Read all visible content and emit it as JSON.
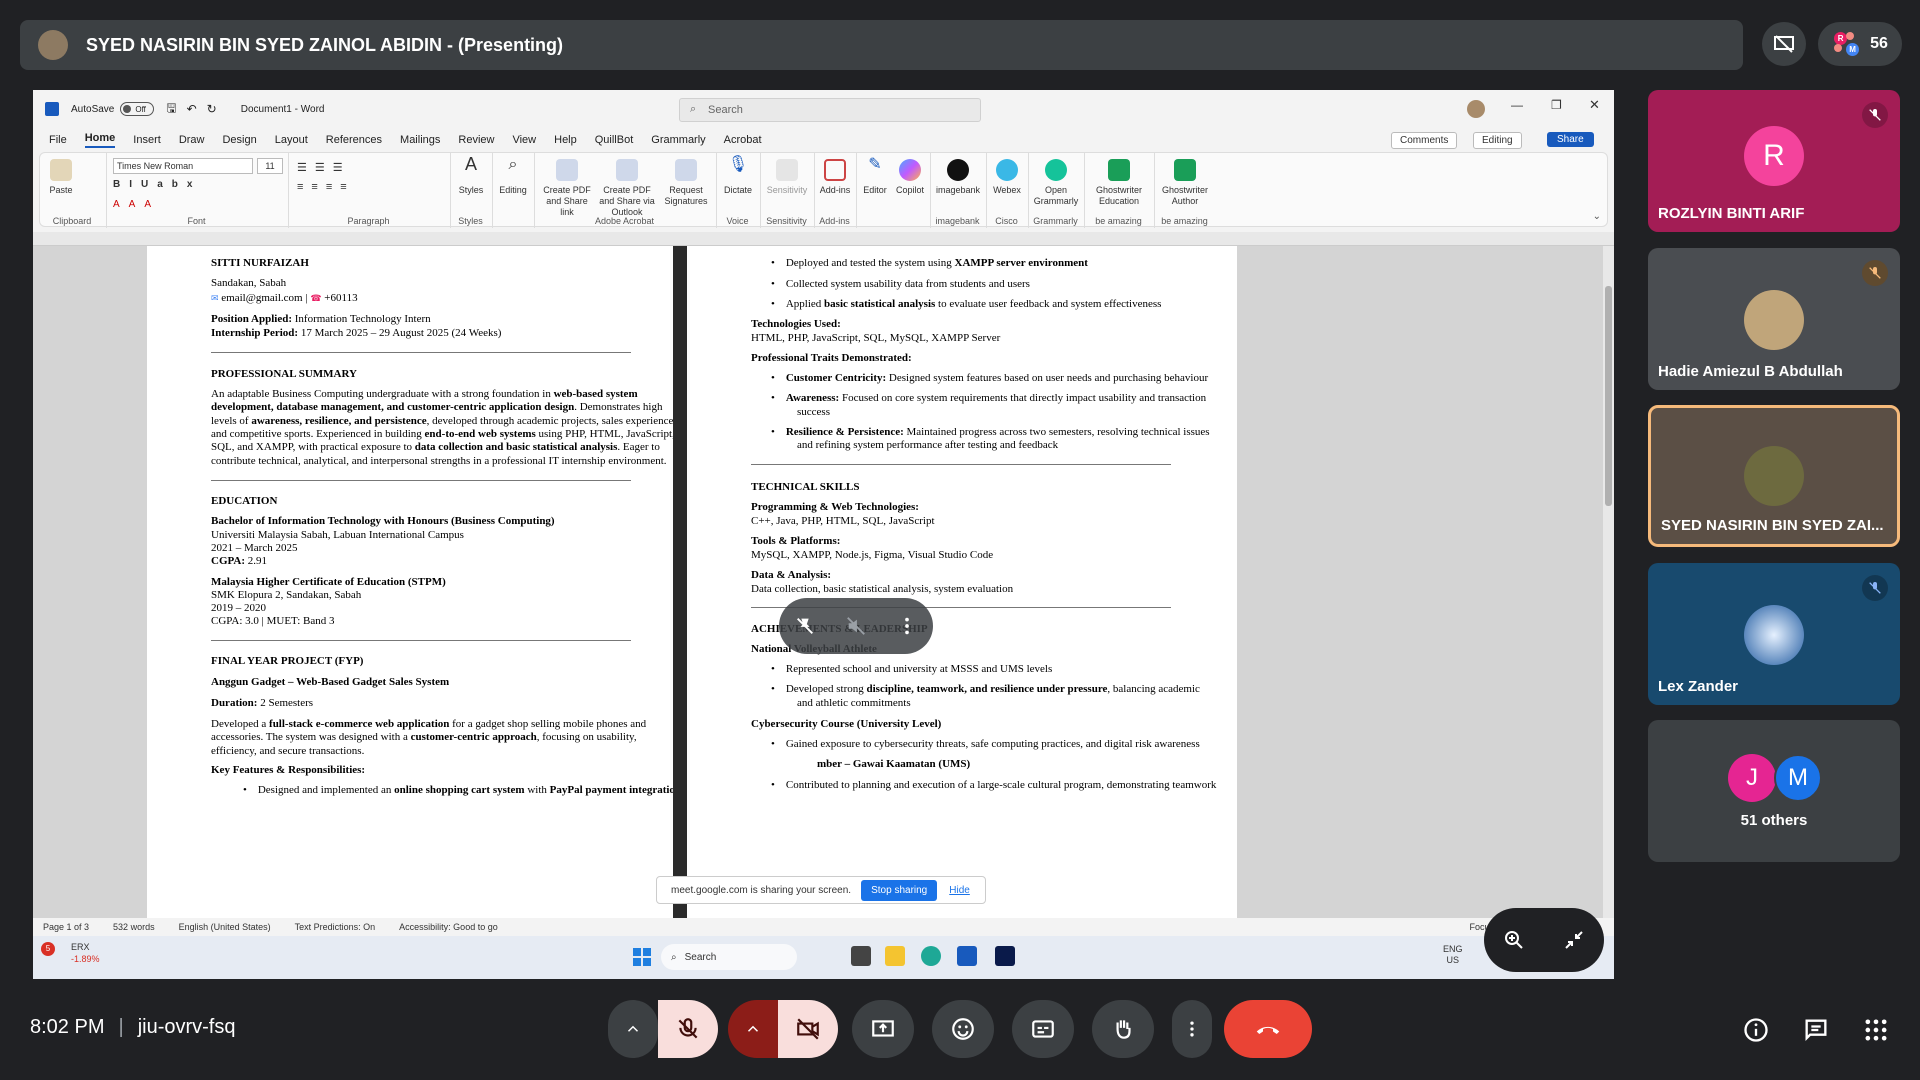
{
  "presenter_bar": {
    "title": "SYED NASIRIN BIN SYED ZAINOL ABIDIN - (Presenting)"
  },
  "top_right": {
    "participants_count": "56",
    "badge_letters": [
      "R",
      "M"
    ]
  },
  "word": {
    "autosave_label": "AutoSave",
    "autosave_state": "Off",
    "doc_title": "Document1 - Word",
    "search_placeholder": "Search",
    "tabs": [
      "File",
      "Home",
      "Insert",
      "Draw",
      "Design",
      "Layout",
      "References",
      "Mailings",
      "Review",
      "View",
      "Help",
      "QuillBot",
      "Grammarly",
      "Acrobat"
    ],
    "comments": "Comments",
    "editing": "Editing",
    "share": "Share",
    "ribbon": {
      "paste": "Paste",
      "clipboard": "Clipboard",
      "font_name": "Times New Roman",
      "font_size": "11",
      "font": "Font",
      "paragraph": "Paragraph",
      "styles_btn": "Styles",
      "styles": "Styles",
      "editing_btn": "Editing",
      "create_pdf": "Create PDF and Share link",
      "create_pdf_outlook": "Create PDF and Share via Outlook",
      "request_sig": "Request Signatures",
      "adobe_acrobat": "Adobe Acrobat",
      "dictate": "Dictate",
      "voice": "Voice",
      "sensitivity_btn": "Sensitivity",
      "sensitivity": "Sensitivity",
      "addins_btn": "Add-ins",
      "addins": "Add-ins",
      "editor": "Editor",
      "copilot": "Copilot",
      "imagebank_btn": "imagebank",
      "imagebank": "imagebank",
      "webex": "Webex",
      "cisco": "Cisco",
      "open_grammarly": "Open Grammarly",
      "grammarly": "Grammarly",
      "ghost_edu": "Ghostwriter Education",
      "ghost_author": "Ghostwriter Author",
      "be_amazing1": "be amazing",
      "be_amazing2": "be amazing"
    },
    "status": {
      "page": "Page 1 of 3",
      "words": "532 words",
      "language": "English (United States)",
      "predictions": "Text Predictions: On",
      "accessibility": "Accessibility: Good to go",
      "focus": "Focus"
    },
    "taskbar": {
      "stock_name": "ERX",
      "stock_change": "-1.89%",
      "stock_badge": "5",
      "search": "Search",
      "lang1": "ENG",
      "lang2": "US"
    }
  },
  "doc_left": {
    "name": "SITTI NURFAIZAH",
    "location": "Sandakan, Sabah",
    "email": "email@gmail.com |",
    "phone": "+60113",
    "pos_label": "Position Applied:",
    "pos_value": " Information Technology Intern",
    "period_label": "Internship Period:",
    "period_value": " 17 March 2025 – 29 August 2025 (24 Weeks)",
    "summary_heading": "PROFESSIONAL SUMMARY",
    "summary": [
      "An adaptable Business Computing undergraduate with a strong foundation in <b>web-based system</b>",
      "<b>development, database management, and customer-centric application design</b>. Demonstrates high",
      "levels of <b>awareness, resilience, and persistence</b>, developed through academic projects, sales experience,",
      "and competitive sports. Experienced in building <b>end-to-end web systems</b> using PHP, HTML, JavaScript,",
      "SQL, and XAMPP, with practical exposure to <b>data collection and basic statistical analysis</b>. Eager to",
      "contribute technical, analytical, and interpersonal strengths in a professional IT internship environment."
    ],
    "education_heading": "EDUCATION",
    "edu1_title": "Bachelor of Information Technology with Honours (Business Computing)",
    "edu1_school": "Universiti Malaysia Sabah, Labuan International Campus",
    "edu1_dates": "2021 – March 2025",
    "edu1_cgpa_label": "CGPA:",
    "edu1_cgpa": " 2.91",
    "edu2_title": "Malaysia Higher Certificate of Education (STPM)",
    "edu2_school": "SMK Elopura 2, Sandakan, Sabah",
    "edu2_dates": "2019 – 2020",
    "edu2_cgpa": "CGPA: 3.0 | MUET: Band 3",
    "fyp_heading": "FINAL YEAR PROJECT (FYP)",
    "fyp_title": "Anggun Gadget – Web-Based Gadget Sales System",
    "fyp_duration_label": "Duration:",
    "fyp_duration": " 2 Semesters",
    "fyp_desc": [
      "Developed a <b>full-stack e-commerce web application</b> for a gadget shop selling mobile phones and",
      "accessories. The system was designed with a <b>customer-centric approach</b>, focusing on usability,",
      "efficiency, and secure transactions."
    ],
    "features_heading": "Key Features & Responsibilities:",
    "features_first": "Designed and implemented an <b>online shopping cart system</b> with <b>PayPal payment integration</b>"
  },
  "doc_right": {
    "bullets_top": [
      "Deployed and tested the system using <b>XAMPP server environment</b>",
      "Collected system usability data from students and users",
      "Applied <b>basic statistical analysis</b> to evaluate user feedback and system effectiveness"
    ],
    "tech_used_label": "Technologies Used:",
    "tech_used": "HTML, PHP, JavaScript, SQL, MySQL, XAMPP Server",
    "traits_label": "Professional Traits Demonstrated:",
    "traits": [
      [
        "<b>Customer Centricity:</b> Designed system features based on user needs and purchasing behaviour"
      ],
      [
        "<b>Awareness:</b> Focused on core system requirements that directly impact usability and transaction",
        "success"
      ],
      [
        "<b>Resilience &amp; Persistence:</b> Maintained progress across two semesters, resolving technical issues",
        "and refining system performance after testing and feedback"
      ]
    ],
    "skills_heading": "TECHNICAL SKILLS",
    "skill1_label": "Programming & Web Technologies:",
    "skill1": "C++, Java, PHP, HTML, SQL, JavaScript",
    "skill2_label": "Tools & Platforms:",
    "skill2": "MySQL, XAMPP, Node.js, Figma, Visual Studio Code",
    "skill3_label": "Data & Analysis:",
    "skill3": "Data collection, basic statistical analysis, system evaluation",
    "ach_heading": "ACHIEVEMENTS & LEADERSHIP",
    "ach1_title": "National Volleyball Athlete",
    "ach1_bullets": [
      [
        "Represented school and university at MSSS and UMS levels"
      ],
      [
        "Developed strong <b>discipline, teamwork, and resilience under pressure</b>, balancing academic",
        "and athletic commitments"
      ]
    ],
    "ach2_title": "Cybersecurity Course (University Level)",
    "ach2_bullet": "Gained exposure to cybersecurity threats, safe computing practices, and digital risk awareness",
    "ach3_title_partial": "mber – Gawai Kaamatan (UMS)",
    "ach3_bullet": "Contributed to planning and execution of a large-scale cultural program, demonstrating teamwork"
  },
  "share_notice": {
    "text": "meet.google.com is sharing your screen.",
    "stop": "Stop sharing",
    "hide": "Hide"
  },
  "participants": [
    {
      "name": "ROZLYIN BINTI ARIF",
      "initial": "R"
    },
    {
      "name": "Hadie Amiezul B Abdullah"
    },
    {
      "name": "SYED NASIRIN BIN SYED ZAI..."
    },
    {
      "name": "Lex Zander"
    },
    {
      "name": "51 others",
      "initials": [
        "J",
        "M"
      ]
    }
  ],
  "meeting": {
    "time": "8:02 PM",
    "code": "jiu-ovrv-fsq"
  },
  "colors": {
    "accent_blue": "#1a73e8",
    "end_call": "#ea4335",
    "mic_off_bg": "#f9dedc",
    "tile_pink": "#a31d55",
    "speaking_border": "#f6ba7b"
  }
}
